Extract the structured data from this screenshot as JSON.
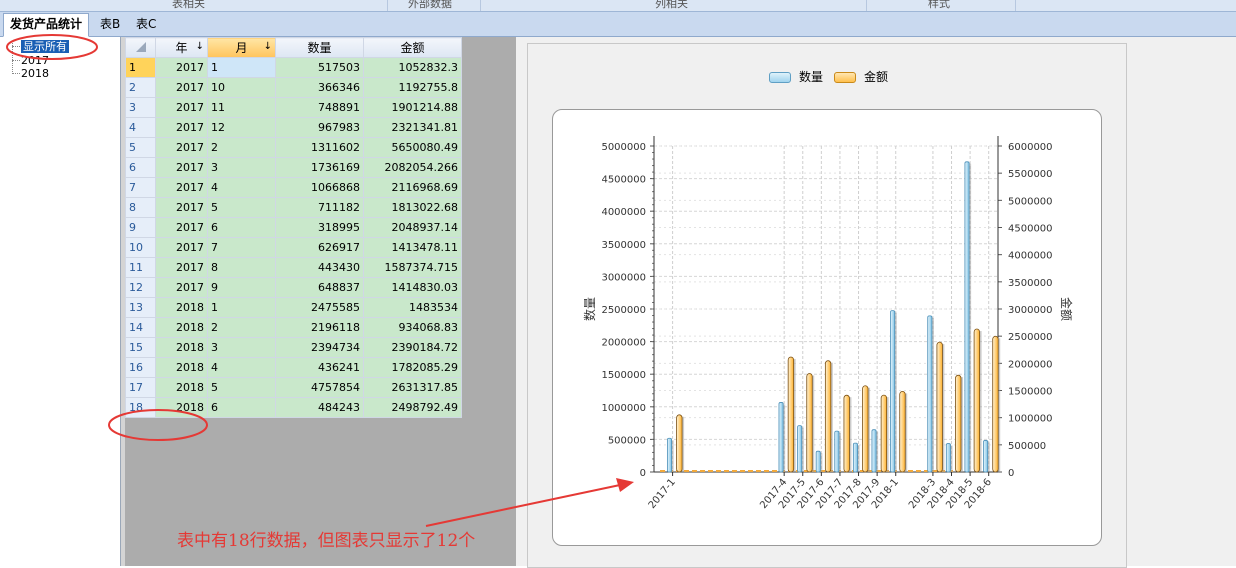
{
  "ribbon": {
    "groups": [
      "表相关",
      "外部数据",
      "列相关",
      "样式"
    ]
  },
  "tabs": [
    {
      "label": "发货产品统计",
      "active": true
    },
    {
      "label": "表B",
      "active": false
    },
    {
      "label": "表C",
      "active": false
    }
  ],
  "tree": {
    "items": [
      "显示所有",
      "2017",
      "2018"
    ],
    "selected": 0
  },
  "grid": {
    "columns": [
      "年",
      "月",
      "数量",
      "金额"
    ],
    "rows": [
      [
        "1",
        "2017",
        "1",
        "517503",
        "1052832.3"
      ],
      [
        "2",
        "2017",
        "10",
        "366346",
        "1192755.8"
      ],
      [
        "3",
        "2017",
        "11",
        "748891",
        "1901214.88"
      ],
      [
        "4",
        "2017",
        "12",
        "967983",
        "2321341.81"
      ],
      [
        "5",
        "2017",
        "2",
        "1311602",
        "5650080.49"
      ],
      [
        "6",
        "2017",
        "3",
        "1736169",
        "2082054.266"
      ],
      [
        "7",
        "2017",
        "4",
        "1066868",
        "2116968.69"
      ],
      [
        "8",
        "2017",
        "5",
        "711182",
        "1813022.68"
      ],
      [
        "9",
        "2017",
        "6",
        "318995",
        "2048937.14"
      ],
      [
        "10",
        "2017",
        "7",
        "626917",
        "1413478.11"
      ],
      [
        "11",
        "2017",
        "8",
        "443430",
        "1587374.715"
      ],
      [
        "12",
        "2017",
        "9",
        "648837",
        "1414830.03"
      ],
      [
        "13",
        "2018",
        "1",
        "2475585",
        "1483534"
      ],
      [
        "14",
        "2018",
        "2",
        "2196118",
        "934068.83"
      ],
      [
        "15",
        "2018",
        "3",
        "2394734",
        "2390184.72"
      ],
      [
        "16",
        "2018",
        "4",
        "436241",
        "1782085.29"
      ],
      [
        "17",
        "2018",
        "5",
        "4757854",
        "2631317.85"
      ],
      [
        "18",
        "2018",
        "6",
        "484243",
        "2498792.49"
      ]
    ]
  },
  "chart_data": {
    "type": "bar",
    "legend": [
      "数量",
      "金额"
    ],
    "legend_position": "top",
    "ylabel_left": "数量",
    "ylabel_right": "金额",
    "ylim_left": [
      0,
      5000000
    ],
    "ylim_right": [
      0,
      6000000
    ],
    "yticks_left": [
      "0",
      "500000",
      "1000000",
      "1500000",
      "2000000",
      "2500000",
      "3000000",
      "3500000",
      "4000000",
      "4500000",
      "5000000"
    ],
    "yticks_right": [
      "0",
      "500000",
      "1000000",
      "1500000",
      "2000000",
      "2500000",
      "3000000",
      "3500000",
      "4000000",
      "4500000",
      "5000000",
      "5500000",
      "6000000"
    ],
    "categories": [
      "2017-1",
      "2017-4",
      "2017-5",
      "2017-6",
      "2017-7",
      "2017-8",
      "2017-9",
      "2018-1",
      "2018-3",
      "2018-4",
      "2018-5",
      "2018-6"
    ],
    "category_positions": [
      1,
      7,
      8,
      9,
      10,
      11,
      12,
      13,
      15,
      16,
      17,
      18
    ],
    "x_span": [
      0,
      18.5
    ],
    "series": [
      {
        "name": "数量",
        "color": "#9fd3ee",
        "values": [
          517503,
          1066868,
          711182,
          318995,
          626917,
          443430,
          648837,
          2475585,
          2394734,
          436241,
          4757854,
          484243
        ]
      },
      {
        "name": "金额",
        "color": "#ffc04d",
        "values": [
          1052832.3,
          2116968.69,
          1813022.68,
          2048937.14,
          1413478.11,
          1587374.715,
          1414830.03,
          1483534,
          2390184.72,
          1782085.29,
          2631317.85,
          2498792.49
        ]
      }
    ],
    "grid": true
  },
  "annotation": "表中有18行数据，但图表只显示了12个"
}
